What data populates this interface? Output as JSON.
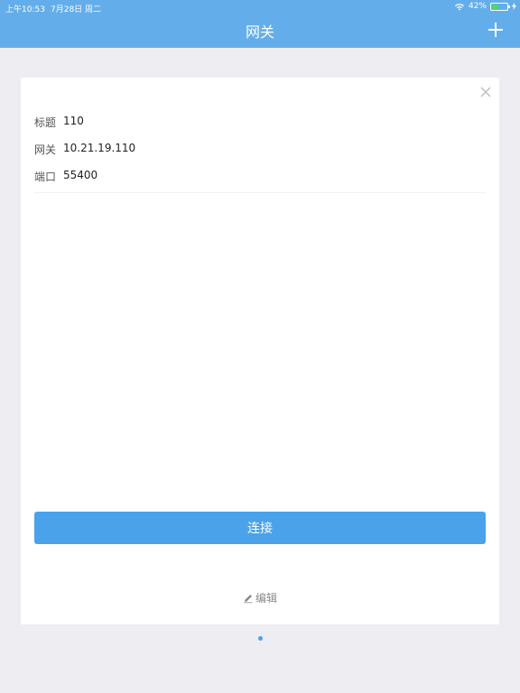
{
  "status_bar": {
    "time": "上午10:53",
    "date": "7月28日 周二",
    "battery": "42%",
    "battery_level": 0.42
  },
  "header": {
    "title": "网关",
    "add_icon": "plus-icon"
  },
  "card": {
    "close_icon": "close-icon",
    "fields": [
      {
        "label": "标题",
        "value": "110"
      },
      {
        "label": "网关",
        "value": "10.21.19.110"
      },
      {
        "label": "端口",
        "value": "55400"
      }
    ],
    "connect_label": "连接",
    "edit_label": "编辑",
    "edit_icon": "pencil-icon"
  },
  "pager": {
    "current": 1,
    "total": 1
  },
  "colors": {
    "header_bg": "#63aeea",
    "accent": "#4aa2ea",
    "page_bg": "#eeedf2"
  }
}
